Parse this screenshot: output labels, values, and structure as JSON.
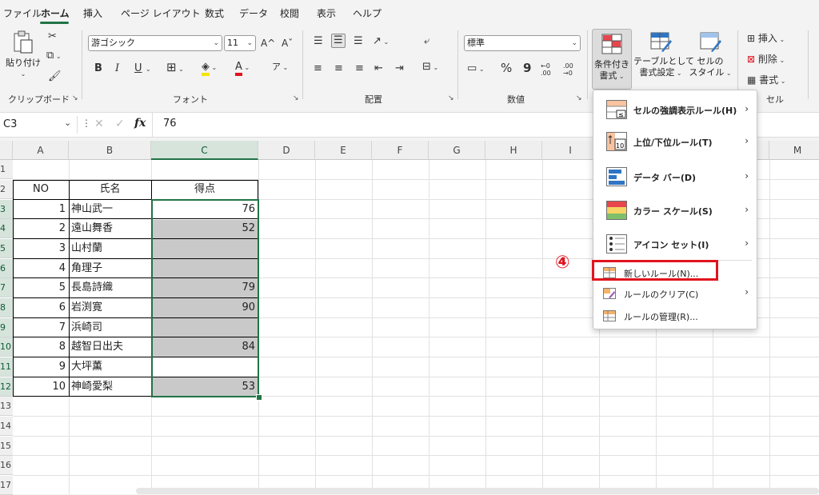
{
  "menu": {
    "items": [
      "ファイル",
      "ホーム",
      "挿入",
      "ページ レイアウト",
      "数式",
      "データ",
      "校閲",
      "表示",
      "ヘルプ"
    ],
    "active": "ホーム"
  },
  "ribbon": {
    "clipboard": {
      "paste_label": "貼り付け",
      "group_label": "クリップボード"
    },
    "font": {
      "font_name": "游ゴシック",
      "font_size": "11",
      "group_label": "フォント",
      "bold": "B",
      "italic": "I",
      "underline": "U",
      "grow": "A^",
      "shrink": "Aˇ",
      "phonetic": "ア"
    },
    "alignment": {
      "group_label": "配置"
    },
    "number": {
      "format": "標準",
      "percent": "%",
      "comma": "9",
      "inc": "←0 .00",
      "dec": ".00 →0",
      "group_label": "数値"
    },
    "styles": {
      "conditional_label_1": "条件付き",
      "conditional_label_2": "書式",
      "table_label_1": "テーブルとして",
      "table_label_2": "書式設定",
      "cell_style_label_1": "セルの",
      "cell_style_label_2": "スタイル"
    },
    "cells": {
      "insert": "挿入",
      "delete": "削除",
      "format": "書式",
      "group_label": "セル"
    }
  },
  "formula_bar": {
    "name_box": "C3",
    "fx": "fx",
    "value": "76"
  },
  "columns": [
    "A",
    "B",
    "C",
    "D",
    "E",
    "F",
    "G",
    "H",
    "I",
    "M"
  ],
  "rows": [
    "1",
    "2",
    "3",
    "4",
    "5",
    "6",
    "7",
    "8",
    "9",
    "10",
    "11",
    "12",
    "13",
    "14",
    "15",
    "16",
    "17"
  ],
  "table": {
    "headers": {
      "no": "NO",
      "name": "氏名",
      "score": "得点"
    },
    "rows": [
      {
        "no": "1",
        "name": "神山武一",
        "score": "76"
      },
      {
        "no": "2",
        "name": "遠山舞香",
        "score": "52"
      },
      {
        "no": "3",
        "name": "山村蘭",
        "score": ""
      },
      {
        "no": "4",
        "name": "角理子",
        "score": ""
      },
      {
        "no": "5",
        "name": "長島詩織",
        "score": "79"
      },
      {
        "no": "6",
        "name": "岩渕寛",
        "score": "90"
      },
      {
        "no": "7",
        "name": "浜崎司",
        "score": ""
      },
      {
        "no": "8",
        "name": "越智日出夫",
        "score": "84"
      },
      {
        "no": "9",
        "name": "大坪薫",
        "score": ""
      },
      {
        "no": "10",
        "name": "神崎愛梨",
        "score": "53"
      }
    ]
  },
  "dropdown": {
    "items": [
      {
        "label": "セルの強調表示ルール(H)",
        "submenu": true
      },
      {
        "label": "上位/下位ルール(T)",
        "submenu": true
      },
      {
        "label": "データ バー(D)",
        "submenu": true
      },
      {
        "label": "カラー スケール(S)",
        "submenu": true
      },
      {
        "label": "アイコン セット(I)",
        "submenu": true
      },
      {
        "label": "新しいルール(N)...",
        "submenu": false
      },
      {
        "label": "ルールのクリア(C)",
        "submenu": true
      },
      {
        "label": "ルールの管理(R)...",
        "submenu": false
      }
    ],
    "top10_icon_text": "10"
  },
  "annotation": {
    "step": "④",
    "color": "#e0141e"
  },
  "colors": {
    "accent": "#217346",
    "highlight_red": "#e0141e",
    "gray_fill": "#c9c9c9"
  }
}
